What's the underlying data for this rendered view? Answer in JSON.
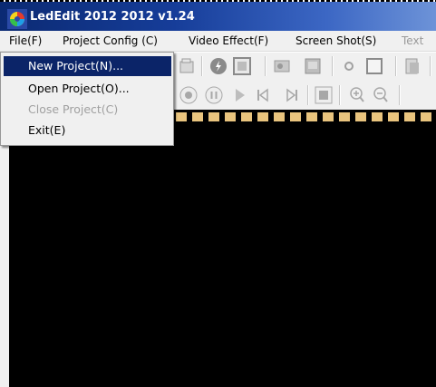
{
  "window": {
    "title": "LedEdit 2012 2012 v1.24"
  },
  "menubar": {
    "items": [
      "File(F)",
      "Project Config (C)",
      "Video Effect(F)",
      "Screen Shot(S)",
      "Text"
    ]
  },
  "file_menu": {
    "items": [
      {
        "label": "New Project(N)...",
        "state": "highlighted"
      },
      {
        "label": "Open Project(O)...",
        "state": "enabled"
      },
      {
        "label": "Close Project(C)",
        "state": "disabled"
      },
      {
        "label": "Exit(E)",
        "state": "enabled"
      }
    ]
  },
  "icons": {
    "app": "app-logo-icon",
    "toolbar1": [
      "folder-icon",
      "flash-icon",
      "rectangle-icon",
      "image-icon",
      "picture-icon",
      "dot-icon",
      "square-icon",
      "paste-icon"
    ],
    "toolbar2": [
      "record-icon",
      "pause-icon",
      "play-icon",
      "previous-icon",
      "next-icon",
      "stop-icon",
      "zoom-in-icon",
      "zoom-out-icon"
    ]
  },
  "colors": {
    "titlebar": "#163d99",
    "menu_highlight": "#0b2468",
    "canvas": "#000000",
    "film_hole": "#e9c47e"
  }
}
